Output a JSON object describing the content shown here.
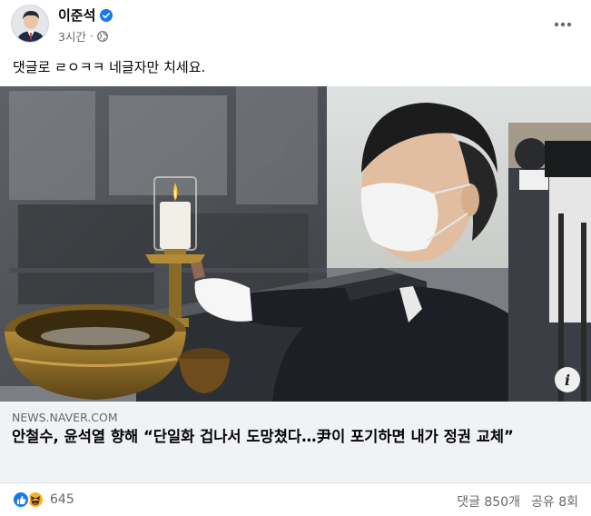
{
  "post": {
    "author": "이준석",
    "time": "3시간",
    "separator": "·",
    "text": "댓글로 ㄹㅇㅋㅋ 네글자만 치세요.",
    "verified_icon": "verified-badge-icon",
    "privacy_icon": "globe-icon",
    "accent_color": "#1877f2"
  },
  "link": {
    "domain": "NEWS.NAVER.COM",
    "title": "안철수, 윤석열 향해 “단일화 겁나서 도망쳤다…尹이 포기하면 내가 정권 교체”",
    "info_icon": "info-icon"
  },
  "footer": {
    "reaction_count": "645",
    "comments": "댓글 850개",
    "shares": "공유 8회",
    "reaction_icons": [
      "like-icon",
      "haha-icon"
    ]
  }
}
